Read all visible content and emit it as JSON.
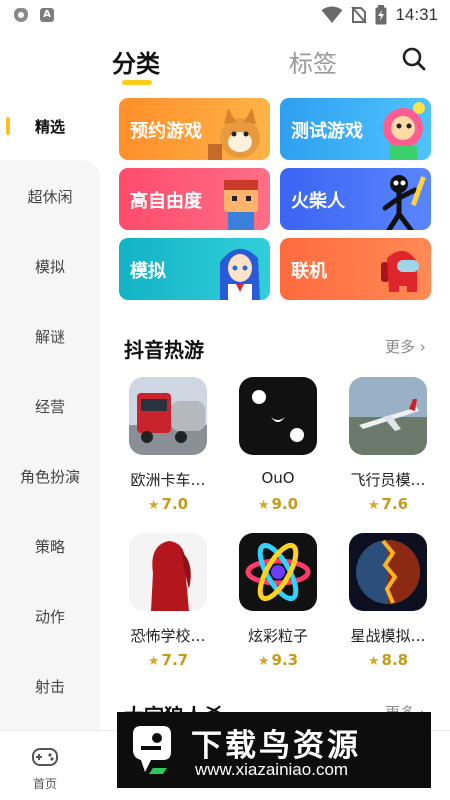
{
  "status_bar": {
    "time": "14:31",
    "left_icons": [
      "shield-icon",
      "a-icon"
    ],
    "right_icons": [
      "wifi-icon",
      "no-sim-icon",
      "battery-charging-icon"
    ]
  },
  "header": {
    "tabs": [
      {
        "label": "分类",
        "active": true
      },
      {
        "label": "标签",
        "active": false
      }
    ],
    "accent": "#ffcc1a"
  },
  "sidebar": {
    "items": [
      {
        "label": "精选",
        "active": true
      },
      {
        "label": "超休闲"
      },
      {
        "label": "模拟"
      },
      {
        "label": "解谜"
      },
      {
        "label": "经营"
      },
      {
        "label": "角色扮演"
      },
      {
        "label": "策略"
      },
      {
        "label": "动作"
      },
      {
        "label": "射击"
      }
    ]
  },
  "categories": [
    {
      "label": "预约游戏",
      "color_a": "#ff9a2b",
      "color_b": "#ffb347"
    },
    {
      "label": "测试游戏",
      "color_a": "#2fa8f0",
      "color_b": "#4fc3ff"
    },
    {
      "label": "高自由度",
      "color_a": "#ff4f6e",
      "color_b": "#ff6f86"
    },
    {
      "label": "火柴人",
      "color_a": "#3d6cf5",
      "color_b": "#5a86ff"
    },
    {
      "label": "模拟",
      "color_a": "#16b9c9",
      "color_b": "#31cfd9"
    },
    {
      "label": "联机",
      "color_a": "#ff6a3d",
      "color_b": "#ff8a55"
    }
  ],
  "hot_section": {
    "title": "抖音热游",
    "more_label": "更多",
    "games": [
      {
        "name": "欧洲卡车…",
        "rating": "7.0",
        "icon": "truck-icon"
      },
      {
        "name": "OuO",
        "rating": "9.0",
        "icon": "dice-icon"
      },
      {
        "name": "飞行员模…",
        "rating": "7.6",
        "icon": "airplane-icon"
      },
      {
        "name": "恐怖学校…",
        "rating": "7.7",
        "icon": "silhouette-icon"
      },
      {
        "name": "炫彩粒子",
        "rating": "9.3",
        "icon": "atom-icon"
      },
      {
        "name": "星战模拟…",
        "rating": "8.8",
        "icon": "planet-explosion-icon"
      }
    ]
  },
  "next_section": {
    "title": "大宗狼人杀",
    "more_label": "更多"
  },
  "bottom_nav": {
    "home_label": "首页"
  },
  "watermark": {
    "title": "下载鸟资源",
    "url": "www.xiazainiao.com"
  }
}
